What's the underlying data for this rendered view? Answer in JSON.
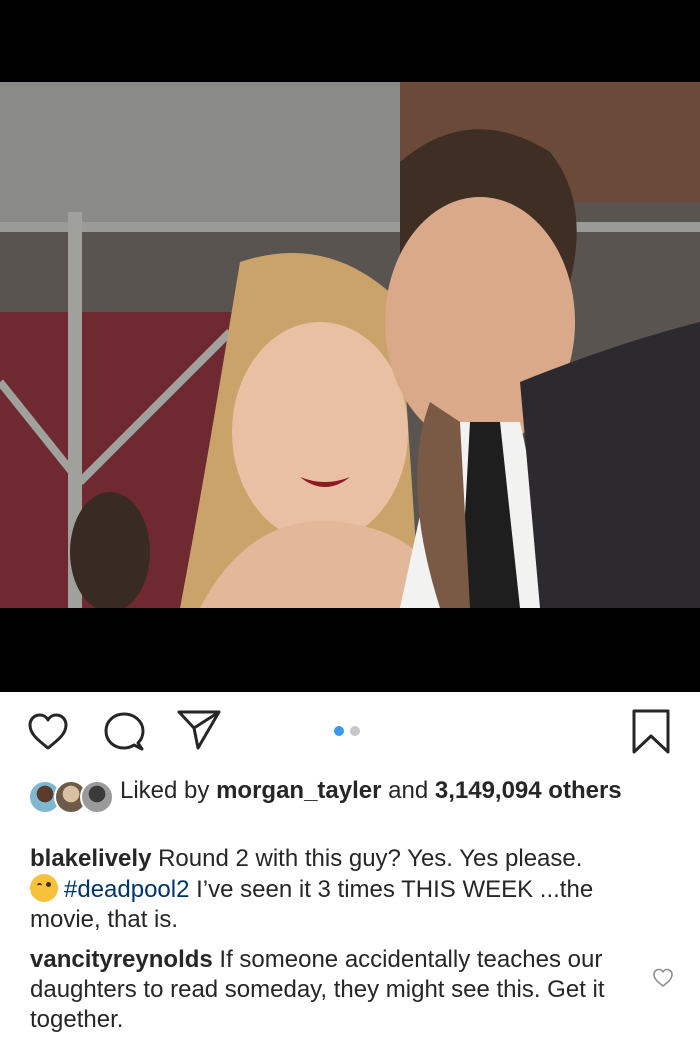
{
  "post": {
    "image_alt": "Selfie photo of two people at a premiere",
    "carousel": {
      "current": 1,
      "total": 2
    }
  },
  "actions": {
    "icons": [
      "heart-icon",
      "comment-icon",
      "share-icon",
      "bookmark-icon"
    ]
  },
  "likes": {
    "prefix": "Liked by ",
    "user": "morgan_tayler",
    "middle": " and ",
    "count": "3,149,094",
    "suffix": " others"
  },
  "caption": {
    "user": "blakelively",
    "text_1": " Round 2 with this guy? Yes. Yes please.",
    "hashtag": "#deadpool2",
    "text_2": " I’ve seen it 3 times THIS WEEK ...the movie, that is."
  },
  "comments": [
    {
      "user": "vancityreynolds",
      "text": " If someone accidentally teaches our daughters to read someday, they might see this. Get it together."
    }
  ],
  "colors": {
    "accent": "#3897f0",
    "text": "#262626",
    "hashtag": "#003569"
  }
}
